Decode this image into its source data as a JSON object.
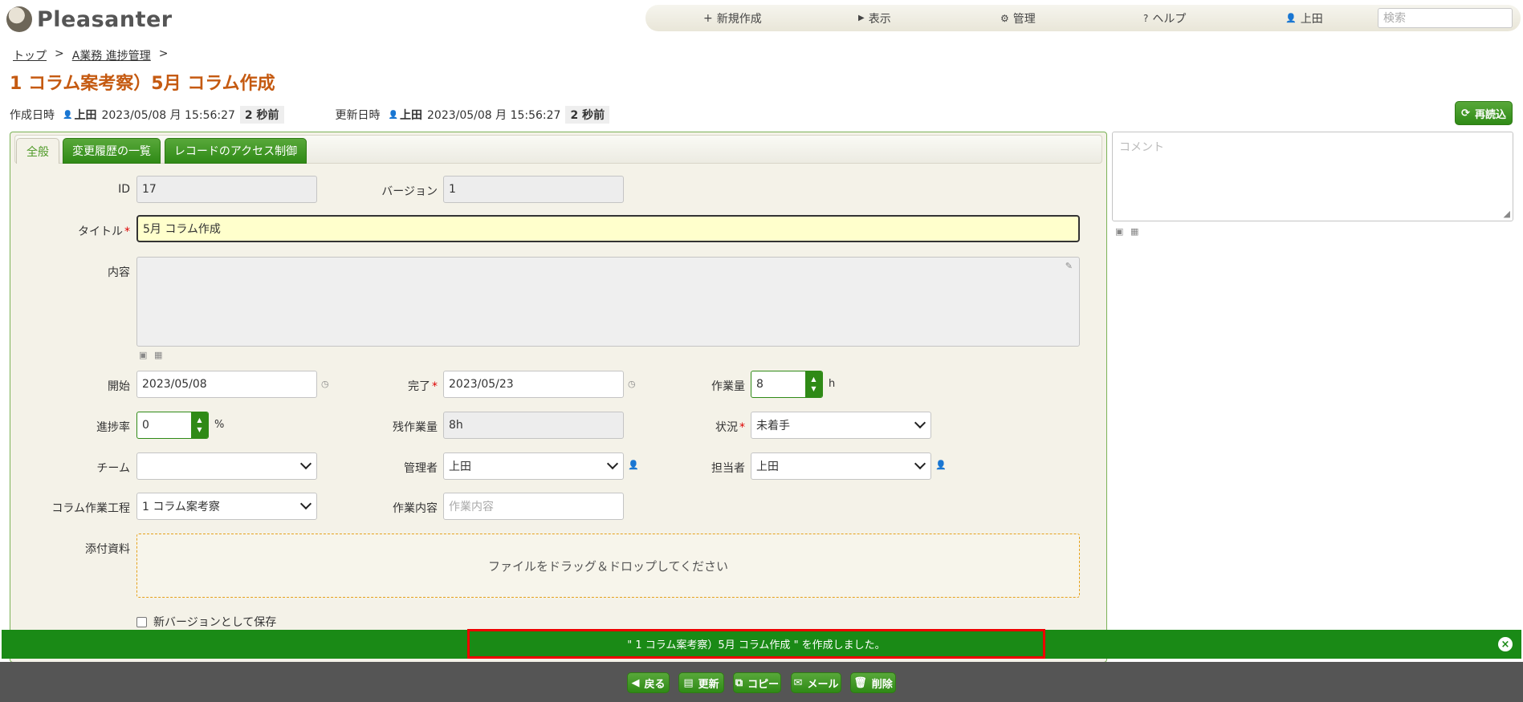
{
  "app": {
    "name": "Pleasanter"
  },
  "nav": {
    "new": "新規作成",
    "view": "表示",
    "manage": "管理",
    "help": "ヘルプ",
    "user": "上田",
    "search_placeholder": "検索"
  },
  "breadcrumb": {
    "top": "トップ",
    "site": "A業務 進捗管理",
    "sep": ">"
  },
  "page": {
    "title": "1 コラム案考察）5月 コラム作成"
  },
  "meta": {
    "created_label": "作成日時",
    "created_user": "上田",
    "created_time": "2023/05/08 月 15:56:27",
    "created_ago": "2 秒前",
    "updated_label": "更新日時",
    "updated_user": "上田",
    "updated_time": "2023/05/08 月 15:56:27",
    "updated_ago": "2 秒前",
    "reload": "再読込"
  },
  "tabs": {
    "general": "全般",
    "history": "変更履歴の一覧",
    "access": "レコードのアクセス制御"
  },
  "form": {
    "id_label": "ID",
    "id_value": "17",
    "version_label": "バージョン",
    "version_value": "1",
    "title_label": "タイトル",
    "title_value": "5月 コラム作成",
    "body_label": "内容",
    "start_label": "開始",
    "start_value": "2023/05/08",
    "end_label": "完了",
    "end_value": "2023/05/23",
    "work_label": "作業量",
    "work_value": "8",
    "work_unit": "h",
    "progress_label": "進捗率",
    "progress_value": "0",
    "progress_unit": "%",
    "remaining_label": "残作業量",
    "remaining_value": "8h",
    "status_label": "状況",
    "status_value": "未着手",
    "team_label": "チーム",
    "team_value": "",
    "manager_label": "管理者",
    "manager_value": "上田",
    "owner_label": "担当者",
    "owner_value": "上田",
    "process_label": "コラム作業工程",
    "process_value": "1 コラム案考察",
    "workcontent_label": "作業内容",
    "workcontent_placeholder": "作業内容",
    "attach_label": "添付資料",
    "attach_hint": "ファイルをドラッグ＆ドロップしてください",
    "newversion_label": "新バージョンとして保存",
    "required_mark": "*"
  },
  "comment": {
    "placeholder": "コメント"
  },
  "message": {
    "text": "\" 1 コラム案考察）5月 コラム作成 \" を作成しました。",
    "close": "×"
  },
  "footer": {
    "back": "戻る",
    "update": "更新",
    "copy": "コピー",
    "mail": "メール",
    "delete": "削除"
  },
  "colors": {
    "accent": "#c55a11",
    "green": "#2f8a16",
    "banner": "#1a8a16"
  }
}
